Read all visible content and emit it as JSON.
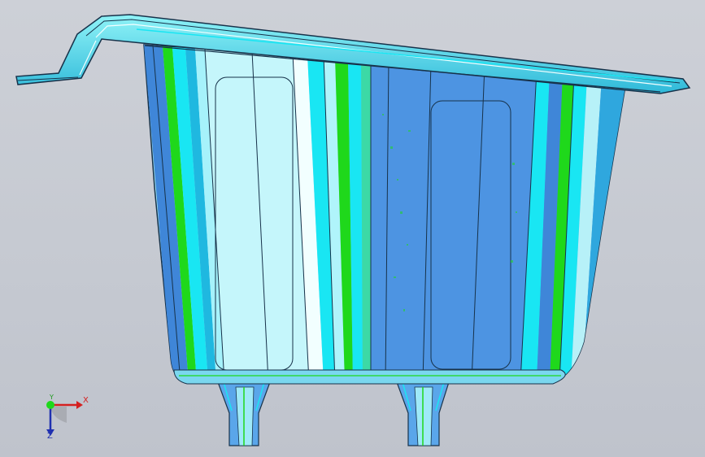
{
  "viewport": {
    "background": "#c8ccd4",
    "model": "bathtub-shell"
  },
  "colors": {
    "outline": "#17324a",
    "blue_face": "#4f96e0",
    "light_face": "#b7f1f8",
    "cyan": "#19e6f3",
    "green": "#1fd81b",
    "rim": "#6fe9f2"
  },
  "triad": {
    "x_label": "X",
    "y_label": "Y",
    "z_label": "Z",
    "x_color": "#d42020",
    "y_color": "#1e9a1e",
    "z_color": "#2030b0"
  }
}
